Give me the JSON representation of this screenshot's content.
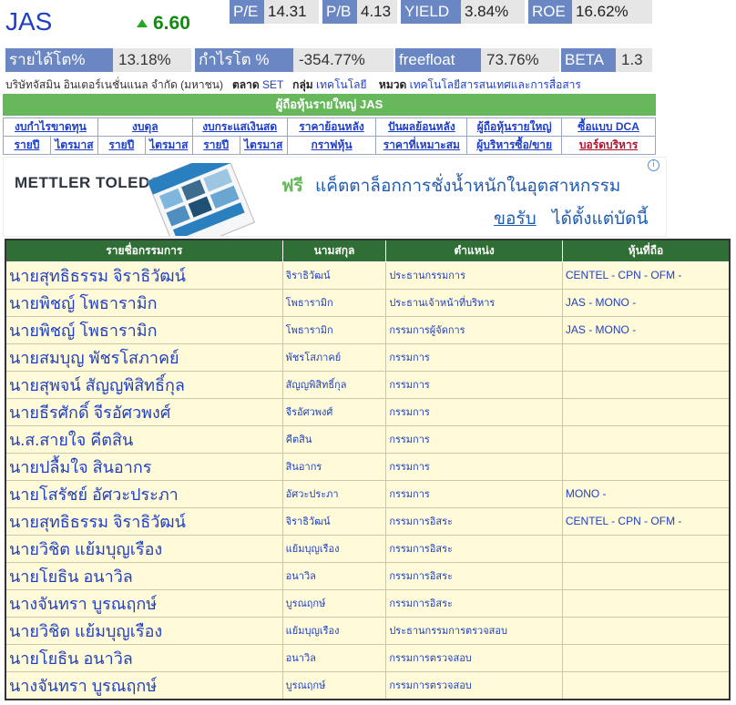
{
  "symbol": "JAS",
  "price": "6.60",
  "stats_row1": [
    {
      "label": "P/E",
      "value": "14.31"
    },
    {
      "label": "P/B",
      "value": "4.13"
    },
    {
      "label": "YIELD",
      "value": "3.84%"
    },
    {
      "label": "ROE",
      "value": "16.62%"
    }
  ],
  "stats_row2": [
    {
      "label": "รายได้โต%",
      "value": "13.18%"
    },
    {
      "label": "กำไรโต %",
      "value": "-354.77%"
    },
    {
      "label": "freefloat",
      "value": "73.76%"
    },
    {
      "label": "BETA",
      "value": "1.3"
    }
  ],
  "company": {
    "name": "บริษัทจัสมิน อินเตอร์เนชั่นแนล จำกัด (มหาชน)",
    "market_label": "ตลาด",
    "market": "SET",
    "group_label": "กลุ่ม",
    "group": "เทคโนโลยี",
    "sector_label": "หมวด",
    "sector": "เทคโนโลยีสารสนเทศและการสื่อสาร"
  },
  "shareholders_bar": "ผู้ถือหุ้นรายใหญ่ JAS",
  "nav": {
    "row1": [
      "งบกำไรขาดทุน",
      "งบดุล",
      "งบกระแสเงินสด",
      "ราคาย้อนหลัง",
      "ปันผลย้อนหลัง",
      "ผู้ถือหุ้นรายใหญ่",
      "ซื้อแบบ DCA"
    ],
    "row2": [
      "รายปี",
      "ไตรมาส",
      "รายปี",
      "ไตรมาส",
      "รายปี",
      "ไตรมาส",
      "กราฟหุ้น",
      "ราคาที่เหมาะสม",
      "ผู้บริหารซื้อ/ขาย",
      "บอร์ดบริหาร"
    ]
  },
  "ad": {
    "logo": "METTLER TOLEDO",
    "free": "ฟรี",
    "line1": "แค็ตตาล็อกการชั่งน้ำหนักในอุตสาหกรรม",
    "cta": "ขอรับ",
    "line2": "ได้ตั้งแต่บัดนี้",
    "badge_icon": "i"
  },
  "directors": {
    "headers": [
      "รายชื่อกรรมการ",
      "นามสกุล",
      "ตำแหน่ง",
      "หุ้นที่ถือ"
    ],
    "rows": [
      [
        "นายสุทธิธรรม จิราธิวัฒน์",
        "จิราธิวัฒน์",
        "ประธานกรรมการ",
        "CENTEL - CPN - OFM -"
      ],
      [
        "นายพิชญ์ โพธารามิก",
        "โพธารามิก",
        "ประธานเจ้าหน้าที่บริหาร",
        "JAS - MONO -"
      ],
      [
        "นายพิชญ์ โพธารามิก",
        "โพธารามิก",
        "กรรมการผู้จัดการ",
        "JAS - MONO -"
      ],
      [
        "นายสมบุญ พัชรโสภาคย์",
        "พัชรโสภาคย์",
        "กรรมการ",
        ""
      ],
      [
        "นายสุพจน์ สัญญพิสิทธิ์กุล",
        "สัญญพิสิทธิ์กุล",
        "กรรมการ",
        ""
      ],
      [
        "นายธีรศักดิ์ จีรอัศวพงศ์",
        "จีรอัศวพงศ์",
        "กรรมการ",
        ""
      ],
      [
        "น.ส.สายใจ คีตสิน",
        "คีตสิน",
        "กรรมการ",
        ""
      ],
      [
        "นายปลื้มใจ สินอากร",
        "สินอากร",
        "กรรมการ",
        ""
      ],
      [
        "นายโสรัชย์ อัศวะประภา",
        "อัศวะประภา",
        "กรรมการ",
        "MONO -"
      ],
      [
        "นายสุทธิธรรม จิราธิวัฒน์",
        "จิราธิวัฒน์",
        "กรรมการอิสระ",
        "CENTEL - CPN - OFM -"
      ],
      [
        "นายวิชิต แย้มบุญเรือง",
        "แย้มบุญเรือง",
        "กรรมการอิสระ",
        ""
      ],
      [
        "นายโยธิน อนาวิล",
        "อนาวิล",
        "กรรมการอิสระ",
        ""
      ],
      [
        "นางจันทรา บูรณฤกษ์",
        "บูรณฤกษ์",
        "กรรมการอิสระ",
        ""
      ],
      [
        "นายวิชิต แย้มบุญเรือง",
        "แย้มบุญเรือง",
        "ประธานกรรมการตรวจสอบ",
        ""
      ],
      [
        "นายโยธิน อนาวิล",
        "อนาวิล",
        "กรรมการตรวจสอบ",
        ""
      ],
      [
        "นางจันทรา บูรณฤกษ์",
        "บูรณฤกษ์",
        "กรรมการตรวจสอบ",
        ""
      ]
    ]
  },
  "colors": {
    "label_bg": "#6a86c3",
    "value_bg": "#e6e6e6",
    "green_bar": "#66b85b",
    "table_header": "#2f6e34",
    "table_bg": "#fffbd9",
    "link": "#1e3fc6",
    "price_up": "#118c11"
  }
}
